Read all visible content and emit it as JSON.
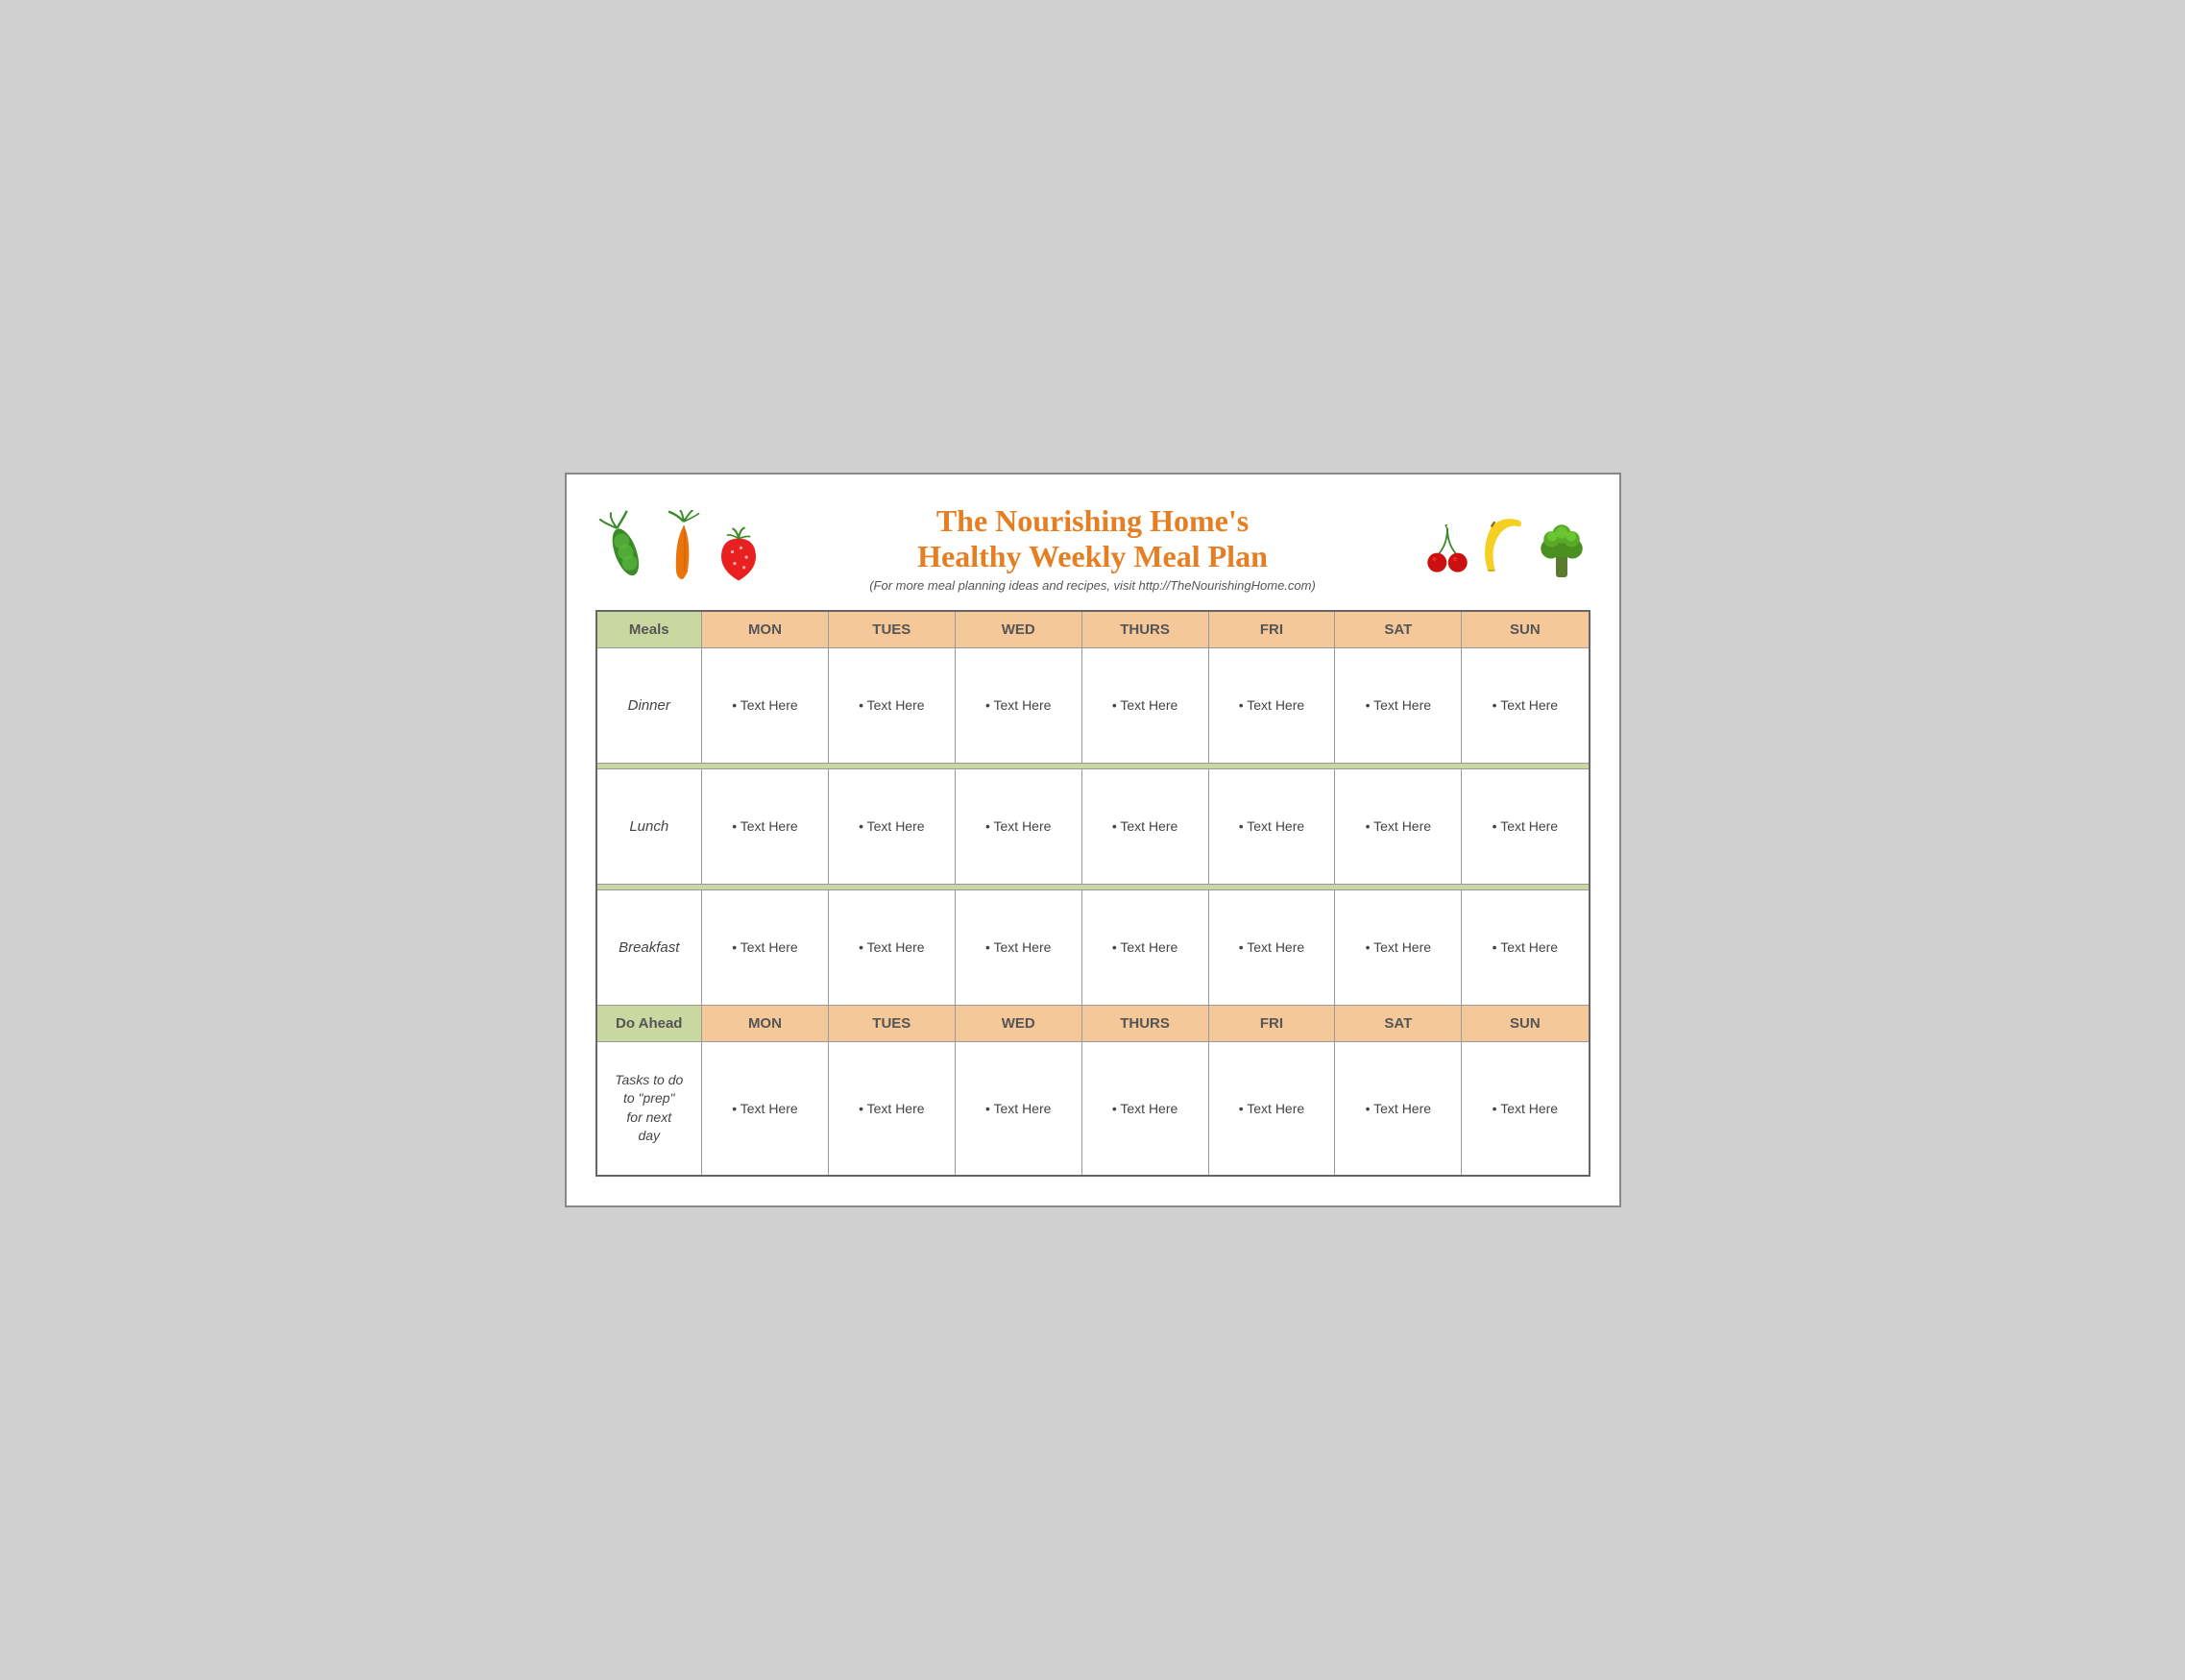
{
  "header": {
    "title_line1": "The Nourishing Home's",
    "title_line2": "Healthy Weekly Meal Plan",
    "subtitle": "(For more meal planning ideas and recipes, visit http://TheNourishingHome.com)"
  },
  "table": {
    "meals_label": "Meals",
    "do_ahead_label": "Do Ahead",
    "days": [
      "MON",
      "TUES",
      "WED",
      "THURS",
      "FRI",
      "SAT",
      "SUN"
    ],
    "rows": [
      {
        "label": "Dinner",
        "cells": [
          "Text Here",
          "Text Here",
          "Text Here",
          "Text Here",
          "Text Here",
          "Text Here",
          "Text Here"
        ]
      },
      {
        "label": "Lunch",
        "cells": [
          "Text Here",
          "Text Here",
          "Text Here",
          "Text Here",
          "Text Here",
          "Text Here",
          "Text Here"
        ]
      },
      {
        "label": "Breakfast",
        "cells": [
          "Text Here",
          "Text Here",
          "Text Here",
          "Text Here",
          "Text Here",
          "Text Here",
          "Text Here"
        ]
      }
    ],
    "tasks_label_line1": "Tasks to do",
    "tasks_label_line2": "to \"prep\"",
    "tasks_label_line3": "for next",
    "tasks_label_line4": "day",
    "tasks_cells": [
      "Text Here",
      "Text Here",
      "Text Here",
      "Text Here",
      "Text Here",
      "Text Here",
      "Text Here"
    ]
  }
}
